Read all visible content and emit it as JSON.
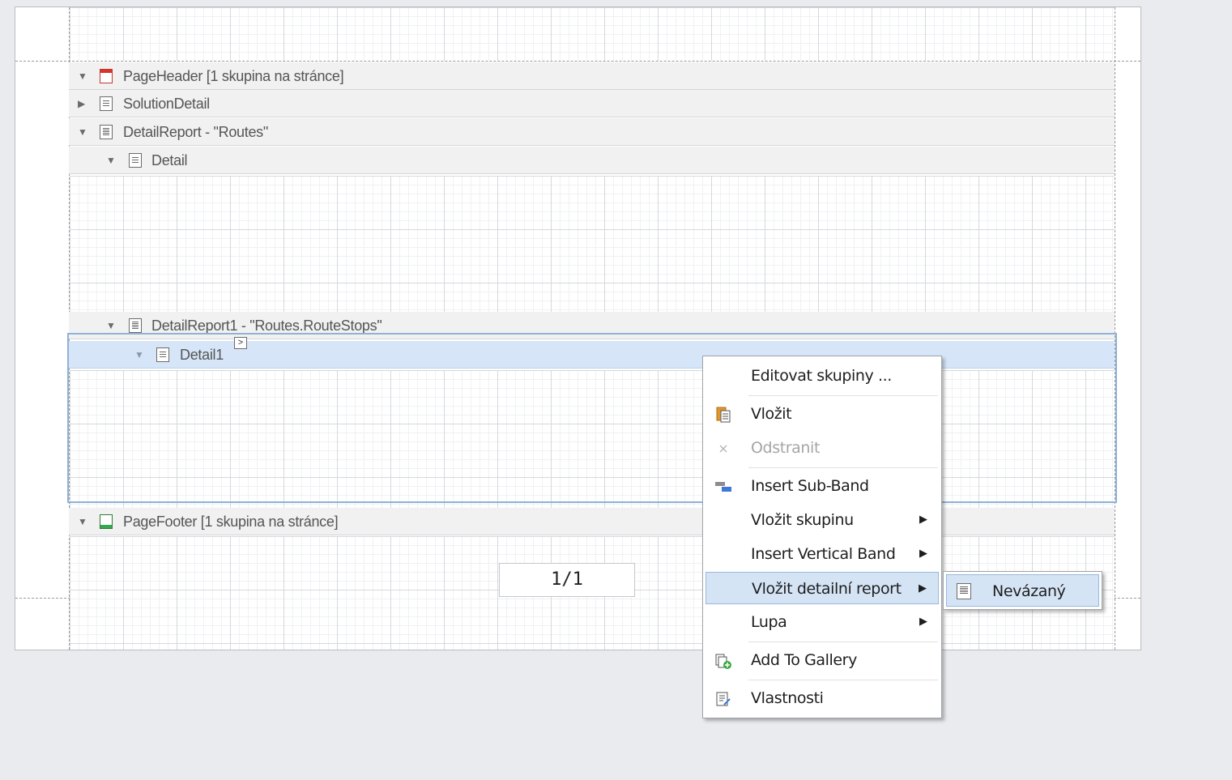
{
  "bands": {
    "page_header": {
      "label": "PageHeader [1 skupina na stránce]"
    },
    "solution_detail": {
      "label": "SolutionDetail"
    },
    "detail_report": {
      "label": "DetailReport - \"Routes\""
    },
    "detail": {
      "label": "Detail"
    },
    "detail_report1": {
      "label": "DetailReport1 - \"Routes.RouteStops\""
    },
    "detail1": {
      "label": "Detail1"
    },
    "page_footer": {
      "label": "PageFooter [1 skupina na stránce]"
    }
  },
  "smart_tag": {
    "glyph": ">"
  },
  "page_number": {
    "text": "1/1"
  },
  "context_menu": {
    "edit_groups": "Editovat skupiny ...",
    "paste": "Vložit",
    "delete": "Odstranit",
    "insert_sub_band": "Insert Sub-Band",
    "insert_group": "Vložit skupinu",
    "insert_vertical_band": "Insert Vertical Band",
    "insert_detail_report": "Vložit detailní report",
    "zoom": "Lupa",
    "add_to_gallery": "Add To Gallery",
    "properties": "Vlastnosti",
    "submenu_arrow": "▶"
  },
  "submenu": {
    "unbound": "Nevázaný"
  },
  "tree_arrows": {
    "expanded": "▼",
    "collapsed": "▶"
  },
  "icons": [
    "band-header-icon",
    "band-detail-icon",
    "detail-report-icon",
    "band-footer-icon",
    "paste-icon",
    "delete-icon",
    "sub-band-icon",
    "gallery-icon",
    "properties-icon"
  ],
  "colors": {
    "selection": "#d6e6f8",
    "header_icon": "#d9342b",
    "footer_icon": "#34a853",
    "menu_hover": "#d5e4f5"
  }
}
